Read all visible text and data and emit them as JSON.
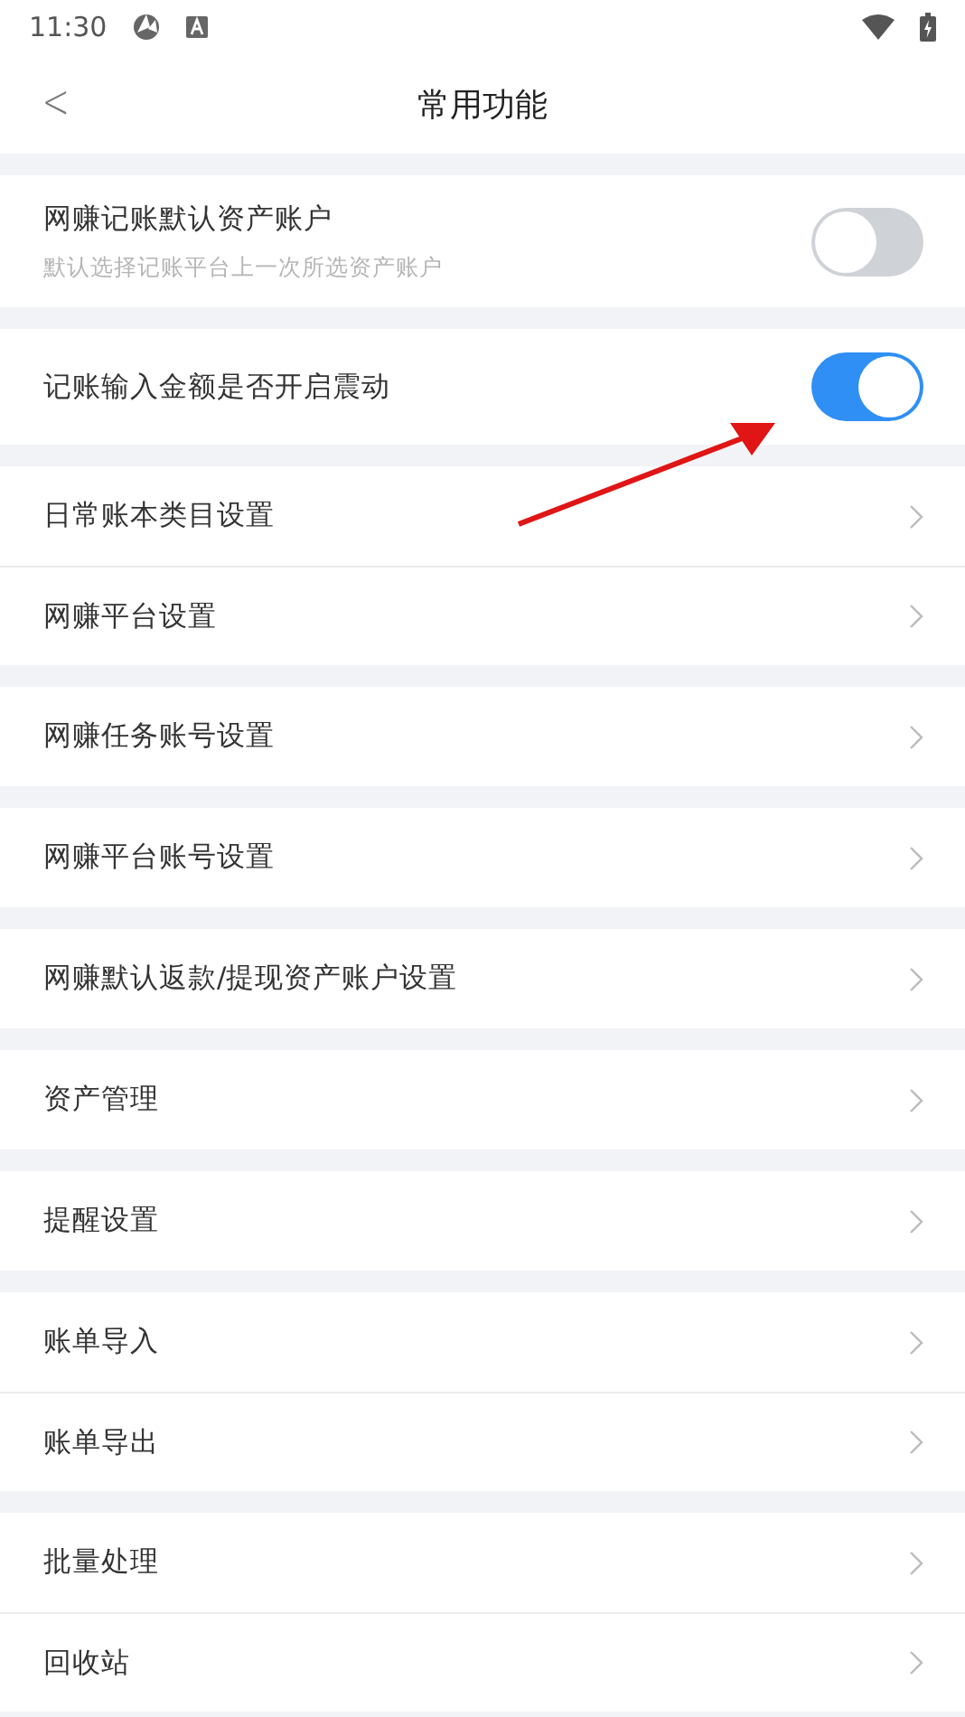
{
  "status_bar": {
    "time": "11:30"
  },
  "nav": {
    "back": "<",
    "title": "常用功能"
  },
  "groups": [
    {
      "items": [
        {
          "kind": "toggle",
          "label": "网赚记账默认资产账户",
          "subtitle": "默认选择记账平台上一次所选资产账户",
          "on": false
        }
      ]
    },
    {
      "items": [
        {
          "kind": "toggle",
          "label": "记账输入金额是否开启震动",
          "on": true
        }
      ]
    },
    {
      "items": [
        {
          "kind": "link",
          "label": "日常账本类目设置"
        },
        {
          "kind": "link",
          "label": "网赚平台设置"
        }
      ]
    },
    {
      "items": [
        {
          "kind": "link",
          "label": "网赚任务账号设置"
        }
      ]
    },
    {
      "items": [
        {
          "kind": "link",
          "label": "网赚平台账号设置"
        }
      ]
    },
    {
      "items": [
        {
          "kind": "link",
          "label": "网赚默认返款/提现资产账户设置"
        }
      ]
    },
    {
      "items": [
        {
          "kind": "link",
          "label": "资产管理"
        }
      ]
    },
    {
      "items": [
        {
          "kind": "link",
          "label": "提醒设置"
        }
      ]
    },
    {
      "items": [
        {
          "kind": "link",
          "label": "账单导入"
        },
        {
          "kind": "link",
          "label": "账单导出"
        }
      ]
    },
    {
      "items": [
        {
          "kind": "link",
          "label": "批量处理"
        },
        {
          "kind": "link",
          "label": "回收站"
        }
      ]
    }
  ]
}
